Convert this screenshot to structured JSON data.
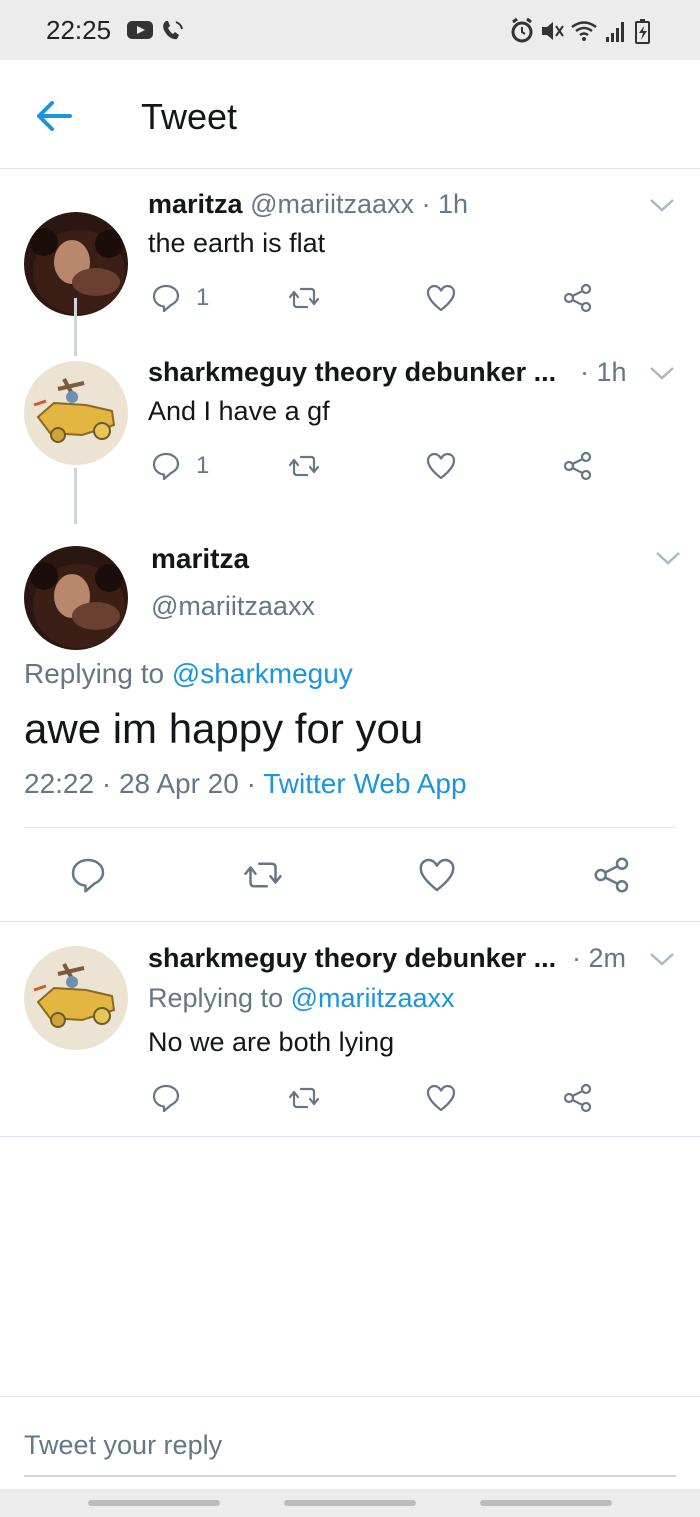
{
  "status_bar": {
    "time": "22:25",
    "icons_left": [
      "youtube-icon",
      "phone-icon"
    ],
    "icons_right": [
      "alarm-icon",
      "mute-icon",
      "wifi-icon",
      "signal-icon",
      "battery-charging-icon"
    ]
  },
  "header": {
    "back_icon": "arrow-left-icon",
    "title": "Tweet"
  },
  "colors": {
    "accent": "#1b95e0",
    "text": "#14171a",
    "muted": "#657786",
    "divider": "#e1e8ed"
  },
  "thread": [
    {
      "name": "maritza",
      "handle": "@mariitzaaxx",
      "time": "· 1h",
      "text": "the earth is flat",
      "reply_count": "1"
    },
    {
      "name": "sharkmeguy theory debunker ...",
      "time": "· 1h",
      "text": "And I have a gf",
      "reply_count": "1"
    }
  ],
  "main_tweet": {
    "name": "maritza",
    "handle": "@mariitzaaxx",
    "replying_prefix": "Replying to",
    "replying_mention": "@sharkmeguy",
    "text": "awe im happy for you",
    "timestamp": "22:22 · 28 Apr 20 · ",
    "source": "Twitter Web App"
  },
  "replies": [
    {
      "name": "sharkmeguy theory debunker ...",
      "time": "· 2m",
      "replying_prefix": "Replying to",
      "replying_mention": "@mariitzaaxx",
      "text": "No we are both lying"
    }
  ],
  "reply_box": {
    "placeholder": "Tweet your reply"
  }
}
